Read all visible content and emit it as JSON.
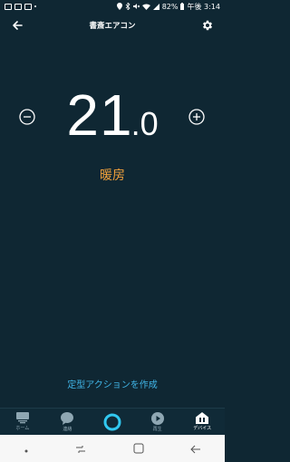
{
  "status": {
    "right_text": "82%",
    "time_text": "午後 3:14"
  },
  "header": {
    "title": "書斎エアコン"
  },
  "thermostat": {
    "temp_int": "21",
    "temp_dec": ".0",
    "mode": "暖房"
  },
  "routine_link": "定型アクションを作成",
  "nav": {
    "items": [
      {
        "label": "ホーム",
        "icon": "home-icon"
      },
      {
        "label": "連絡",
        "icon": "chat-icon"
      },
      {
        "label": "",
        "icon": "alexa-icon"
      },
      {
        "label": "再生",
        "icon": "play-icon"
      },
      {
        "label": "デバイス",
        "icon": "devices-icon"
      }
    ]
  },
  "colors": {
    "background": "#0f2733",
    "mode": "#f2a23c",
    "link": "#40b4e6",
    "alexa": "#31c8f0"
  }
}
